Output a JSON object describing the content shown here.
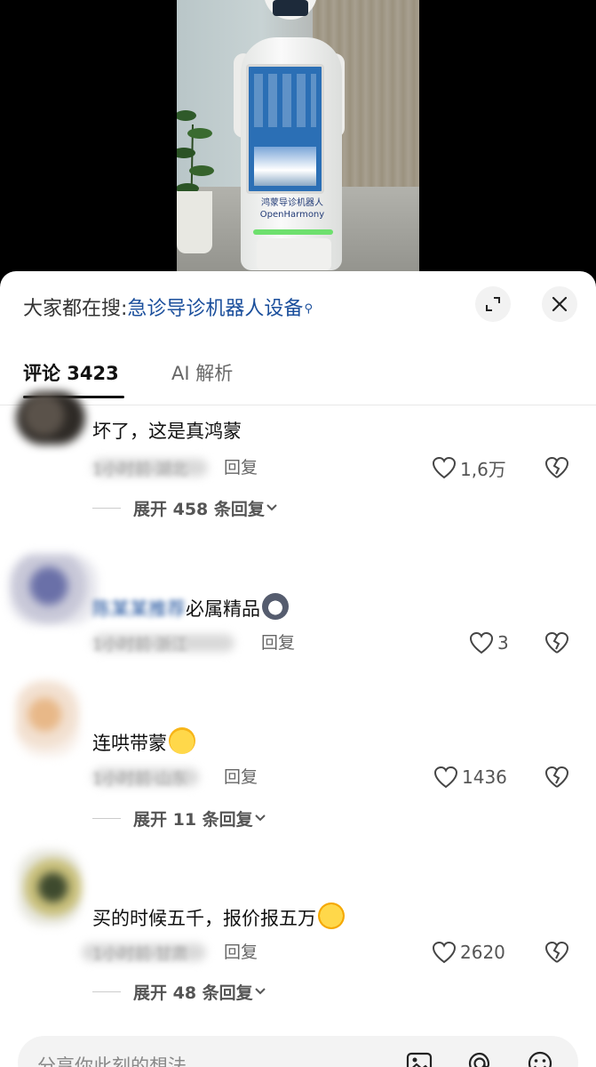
{
  "video": {
    "robot_label_line1": "鸿蒙导诊机器人",
    "robot_label_line2": "OpenHarmony"
  },
  "search": {
    "prefix": "大家都在搜:",
    "query": "急诊导诊机器人设备",
    "query_icon": "search-icon"
  },
  "header_buttons": {
    "expand_icon": "expand-icon",
    "close_icon": "close-icon"
  },
  "tabs": [
    {
      "label": "评论 3423",
      "active": true
    },
    {
      "label": "AI 解析",
      "active": false
    }
  ],
  "comments": [
    {
      "text": "坏了，这是真鸿蒙",
      "meta_blurred": "1小时前·湖北",
      "reply_label": "回复",
      "likes": "1,6万",
      "expand_label": "展开 458 条回复"
    },
    {
      "text_prefix_link": "陈某某推荐",
      "text": "必属精品",
      "emoji": "wolf-emoji",
      "meta_blurred": "1小时前·浙江",
      "reply_label": "回复",
      "likes": "3"
    },
    {
      "text": "连哄带蒙",
      "emoji": "sun-emoji",
      "meta_blurred": "1小时前·山东",
      "reply_label": "回复",
      "likes": "1436",
      "expand_label": "展开 11 条回复"
    },
    {
      "text": "买的时候五千，报价报五万",
      "emoji": "wink-emoji",
      "meta_blurred": "1小时前·甘肃",
      "reply_label": "回复",
      "likes": "2620",
      "expand_label": "展开 48 条回复"
    }
  ],
  "input": {
    "placeholder": "分享你此刻的想法",
    "icons": [
      "image-icon",
      "at-icon",
      "emoji-icon"
    ]
  },
  "colors": {
    "link": "#1b4f9c",
    "text": "#111111",
    "muted": "#666666"
  }
}
